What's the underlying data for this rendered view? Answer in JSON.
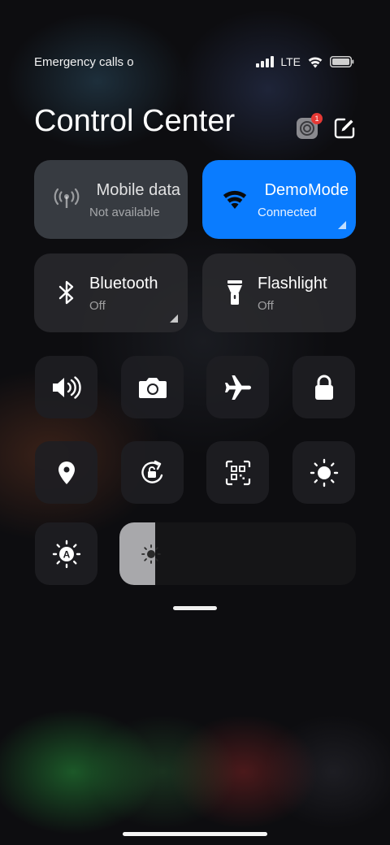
{
  "status_bar": {
    "carrier_text": "Emergency calls o",
    "network": "LTE",
    "signal_icon": "signal-bars-icon",
    "wifi_icon": "wifi-icon",
    "battery_icon": "battery-icon"
  },
  "header": {
    "title": "Control Center",
    "settings_icon": "settings-gear-icon",
    "settings_badge": "1",
    "edit_icon": "edit-icon"
  },
  "tiles": {
    "mobile_data": {
      "label": "Mobile data",
      "status": "Not available",
      "icon": "antenna-icon"
    },
    "wifi": {
      "label": "DemoMode",
      "status": "Connected",
      "icon": "wifi-icon",
      "color": "#0A7CFF"
    },
    "bluetooth": {
      "label": "Bluetooth",
      "status": "Off",
      "icon": "bluetooth-icon"
    },
    "flashlight": {
      "label": "Flashlight",
      "status": "Off",
      "icon": "flashlight-icon"
    }
  },
  "toggles": [
    {
      "name": "sound",
      "icon": "speaker-icon"
    },
    {
      "name": "screenshot",
      "icon": "camera-icon"
    },
    {
      "name": "airplane-mode",
      "icon": "airplane-icon"
    },
    {
      "name": "lock-screen",
      "icon": "lock-icon"
    },
    {
      "name": "location",
      "icon": "location-pin-icon"
    },
    {
      "name": "rotation-lock",
      "icon": "rotation-lock-icon"
    },
    {
      "name": "scanner",
      "icon": "qr-scanner-icon"
    },
    {
      "name": "dark-mode",
      "icon": "dark-mode-icon"
    },
    {
      "name": "auto-brightness",
      "icon": "auto-brightness-icon"
    }
  ],
  "brightness": {
    "level": 0.15,
    "icon": "sun-icon"
  },
  "colors": {
    "accent": "#0A7CFF",
    "badge": "#E53935"
  }
}
